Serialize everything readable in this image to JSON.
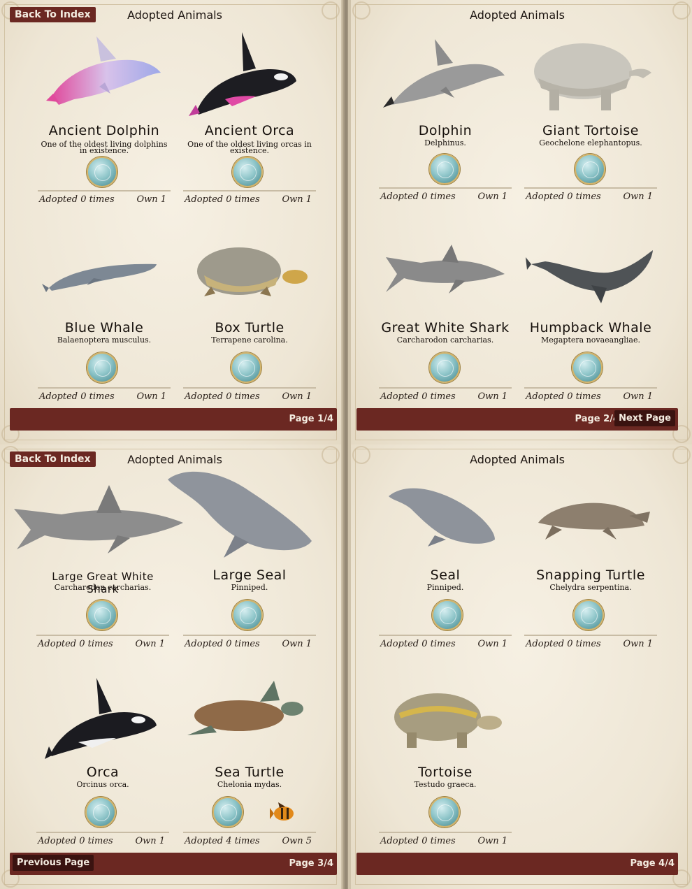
{
  "back_label": "Back To Index",
  "book_title": "Adopted Animals",
  "previous_label": "Previous Page",
  "next_label": "Next Page",
  "pages": [
    {
      "number": "Page 1/4",
      "animals": [
        {
          "name": "Ancient Dolphin",
          "sci": "One of the oldest living dolphins in existence.",
          "adopted": "Adopted 0 times",
          "own": "Own 1",
          "icon": "ancient-dolphin-image"
        },
        {
          "name": "Ancient Orca",
          "sci": "One of the oldest living orcas in existence.",
          "adopted": "Adopted 0 times",
          "own": "Own 1",
          "icon": "ancient-orca-image"
        },
        {
          "name": "Blue Whale",
          "sci": "Balaenoptera musculus.",
          "adopted": "Adopted 0 times",
          "own": "Own 1",
          "icon": "blue-whale-image"
        },
        {
          "name": "Box Turtle",
          "sci": "Terrapene carolina.",
          "adopted": "Adopted 0 times",
          "own": "Own 1",
          "icon": "box-turtle-image"
        }
      ]
    },
    {
      "number": "Page 2/4",
      "animals": [
        {
          "name": "Dolphin",
          "sci": "Delphinus.",
          "adopted": "Adopted 0 times",
          "own": "Own 1",
          "icon": "dolphin-image"
        },
        {
          "name": "Giant Tortoise",
          "sci": "Geochelone elephantopus.",
          "adopted": "Adopted 0 times",
          "own": "Own 1",
          "icon": "giant-tortoise-image"
        },
        {
          "name": "Great White Shark",
          "sci": "Carcharodon carcharias.",
          "adopted": "Adopted 0 times",
          "own": "Own 1",
          "icon": "great-white-shark-image"
        },
        {
          "name": "Humpback Whale",
          "sci": "Megaptera novaeangliae.",
          "adopted": "Adopted 0 times",
          "own": "Own 1",
          "icon": "humpback-whale-image"
        }
      ]
    },
    {
      "number": "Page 3/4",
      "animals": [
        {
          "name": "Large Great White Shark",
          "sci": "Carcharodon carcharias.",
          "adopted": "Adopted 0 times",
          "own": "Own 1",
          "icon": "large-great-white-shark-image"
        },
        {
          "name": "Large Seal",
          "sci": "Pinniped.",
          "adopted": "Adopted 0 times",
          "own": "Own 1",
          "icon": "large-seal-image"
        },
        {
          "name": "Orca",
          "sci": "Orcinus orca.",
          "adopted": "Adopted 0 times",
          "own": "Own 1",
          "icon": "orca-image"
        },
        {
          "name": "Sea Turtle",
          "sci": "Chelonia mydas.",
          "adopted": "Adopted 4 times",
          "own": "Own 5",
          "icon": "sea-turtle-image"
        }
      ]
    },
    {
      "number": "Page 4/4",
      "animals": [
        {
          "name": "Seal",
          "sci": "Pinniped.",
          "adopted": "Adopted 0 times",
          "own": "Own 1",
          "icon": "seal-image"
        },
        {
          "name": "Snapping Turtle",
          "sci": "Chelydra serpentina.",
          "adopted": "Adopted 0 times",
          "own": "Own 1",
          "icon": "snapping-turtle-image"
        },
        {
          "name": "Tortoise",
          "sci": "Testudo graeca.",
          "adopted": "Adopted 0 times",
          "own": "Own 1",
          "icon": "tortoise-image"
        }
      ]
    }
  ],
  "colors": {
    "bar": "#6b2822",
    "paper": "#f1eadb",
    "coin": "#8ec5c9"
  }
}
